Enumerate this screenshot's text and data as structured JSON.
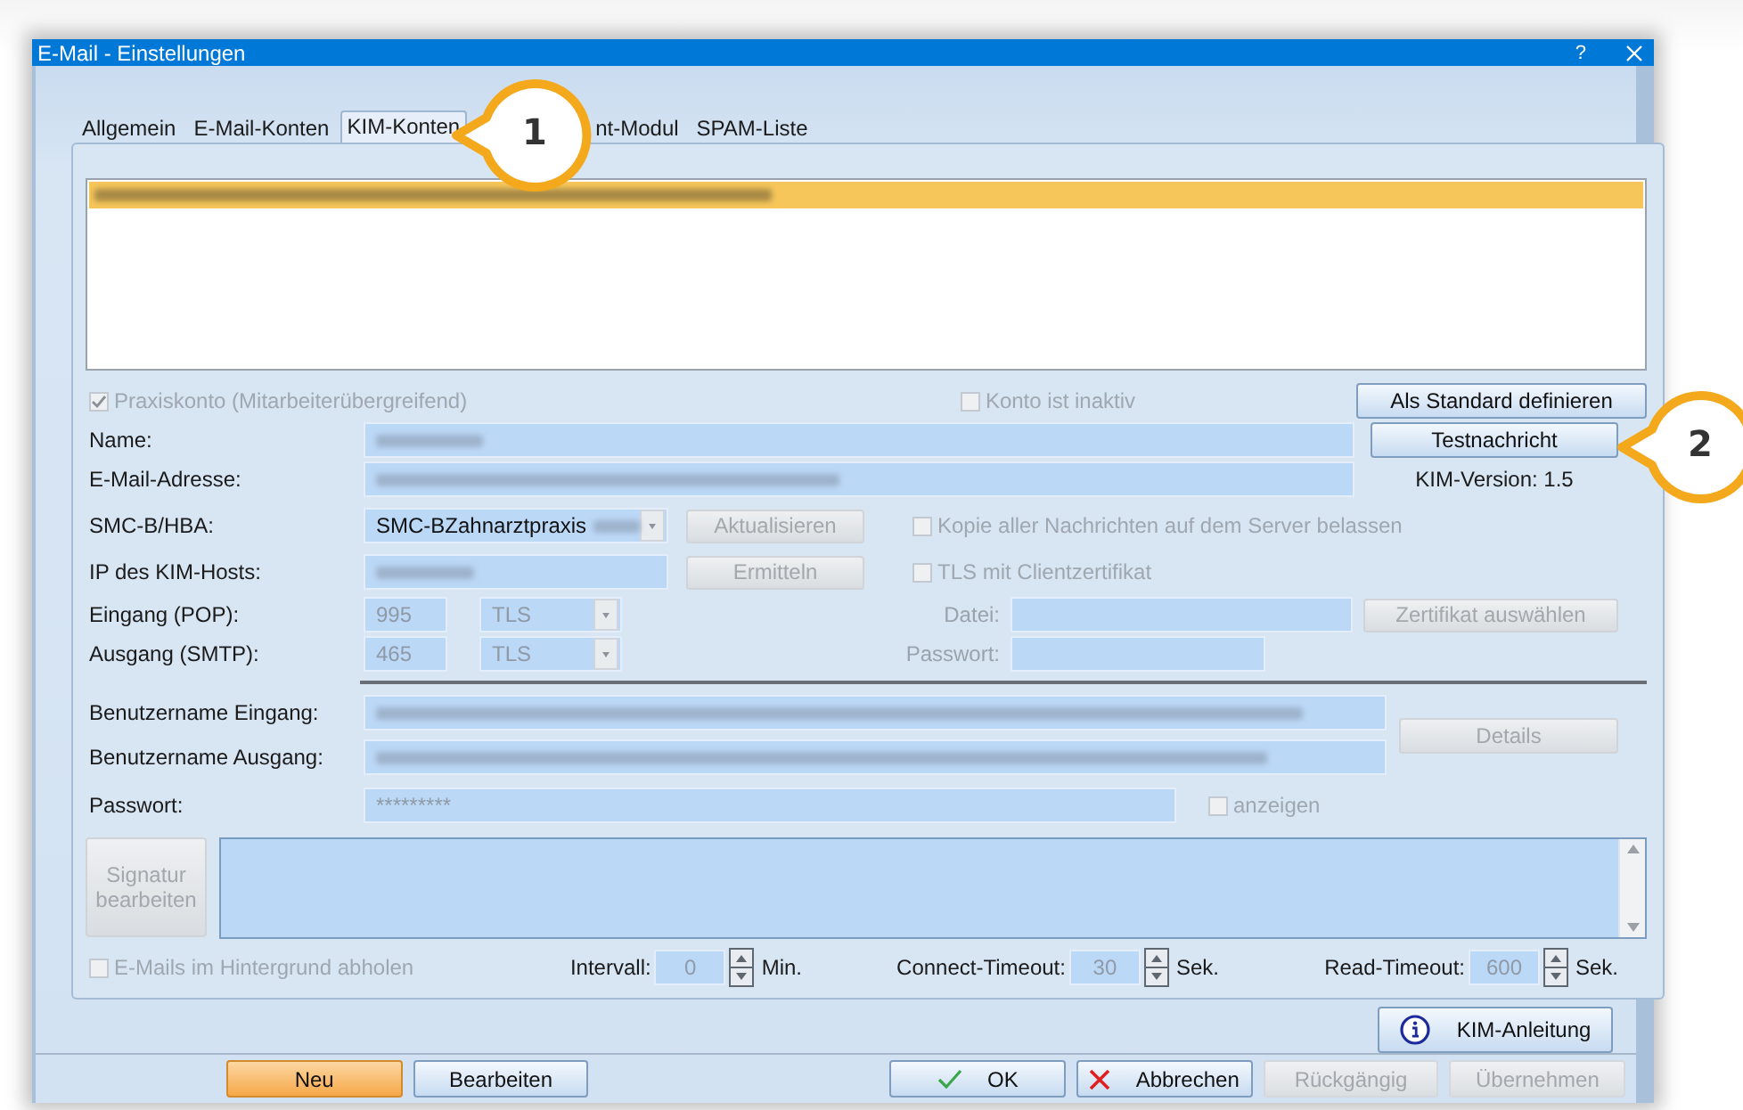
{
  "window": {
    "title": "E-Mail - Einstellungen",
    "help": "?"
  },
  "tabs": [
    {
      "label": "Allgemein",
      "selected": false
    },
    {
      "label": "E-Mail-Konten",
      "selected": false
    },
    {
      "label": "KIM-Konten",
      "selected": true
    },
    {
      "label": "nt-Modul",
      "selected": false,
      "covered": true
    },
    {
      "label": "SPAM-Liste",
      "selected": false
    }
  ],
  "accounts": [
    {
      "selected": true
    }
  ],
  "praxiskonto": {
    "label": "Praxiskonto (Mitarbeiterübergreifend)",
    "checked": true,
    "disabled": true
  },
  "inactive": {
    "label": "Konto ist inaktiv",
    "checked": false,
    "disabled": true
  },
  "set_default_button": {
    "label": "Als Standard definieren",
    "disabled": false
  },
  "test_button": {
    "label": "Testnachricht",
    "disabled": false
  },
  "kim_version": "KIM-Version: 1.5",
  "name": {
    "label": "Name:"
  },
  "email": {
    "label": "E-Mail-Adresse:"
  },
  "smc": {
    "label": "SMC-B/HBA:",
    "value": "SMC-BZahnarztpraxis"
  },
  "refresh_button": {
    "label": "Aktualisieren",
    "disabled": true
  },
  "keep_copy": {
    "label": "Kopie aller Nachrichten auf dem Server belassen",
    "checked": false,
    "disabled": true
  },
  "host": {
    "label": "IP des KIM-Hosts:"
  },
  "detect_button": {
    "label": "Ermitteln",
    "disabled": true
  },
  "client_cert": {
    "label": "TLS mit Clientzertifikat",
    "checked": false,
    "disabled": true
  },
  "incoming": {
    "label": "Eingang (POP):",
    "port": "995",
    "security": "TLS"
  },
  "outgoing": {
    "label": "Ausgang (SMTP):",
    "port": "465",
    "security": "TLS"
  },
  "cert_file": {
    "label": "Datei:"
  },
  "cert_password": {
    "label": "Passwort:"
  },
  "cert_button": {
    "label": "Zertifikat auswählen",
    "disabled": true
  },
  "user_in": {
    "label": "Benutzername Eingang:"
  },
  "user_out": {
    "label": "Benutzername Ausgang:"
  },
  "details_button": {
    "label": "Details",
    "disabled": true
  },
  "password": {
    "label": "Passwort:",
    "value": "*********"
  },
  "show_password": {
    "label": "anzeigen",
    "checked": false,
    "disabled": true
  },
  "signature_button": {
    "label": "Signatur bearbeiten",
    "disabled": true
  },
  "background_fetch": {
    "label": "E-Mails im Hintergrund abholen",
    "checked": false,
    "disabled": true
  },
  "timers": [
    {
      "label": "Intervall:",
      "value": "0",
      "unit": "Min."
    },
    {
      "label": "Connect-Timeout:",
      "value": "30",
      "unit": "Sek."
    },
    {
      "label": "Read-Timeout:",
      "value": "600",
      "unit": "Sek."
    }
  ],
  "guide_button": {
    "label": "KIM-Anleitung"
  },
  "footer_left": [
    {
      "label": "Neu",
      "kind": "primary",
      "disabled": false
    },
    {
      "label": "Bearbeiten",
      "kind": "plain",
      "disabled": false
    }
  ],
  "footer_right": [
    {
      "label": "OK",
      "kind": "confirm",
      "disabled": false
    },
    {
      "label": "Abbrechen",
      "kind": "cancel",
      "disabled": false
    },
    {
      "label": "Rückgängig",
      "kind": "plain",
      "disabled": true
    },
    {
      "label": "Übernehmen",
      "kind": "plain",
      "disabled": true
    }
  ],
  "callouts": [
    {
      "number": "1"
    },
    {
      "number": "2"
    }
  ]
}
